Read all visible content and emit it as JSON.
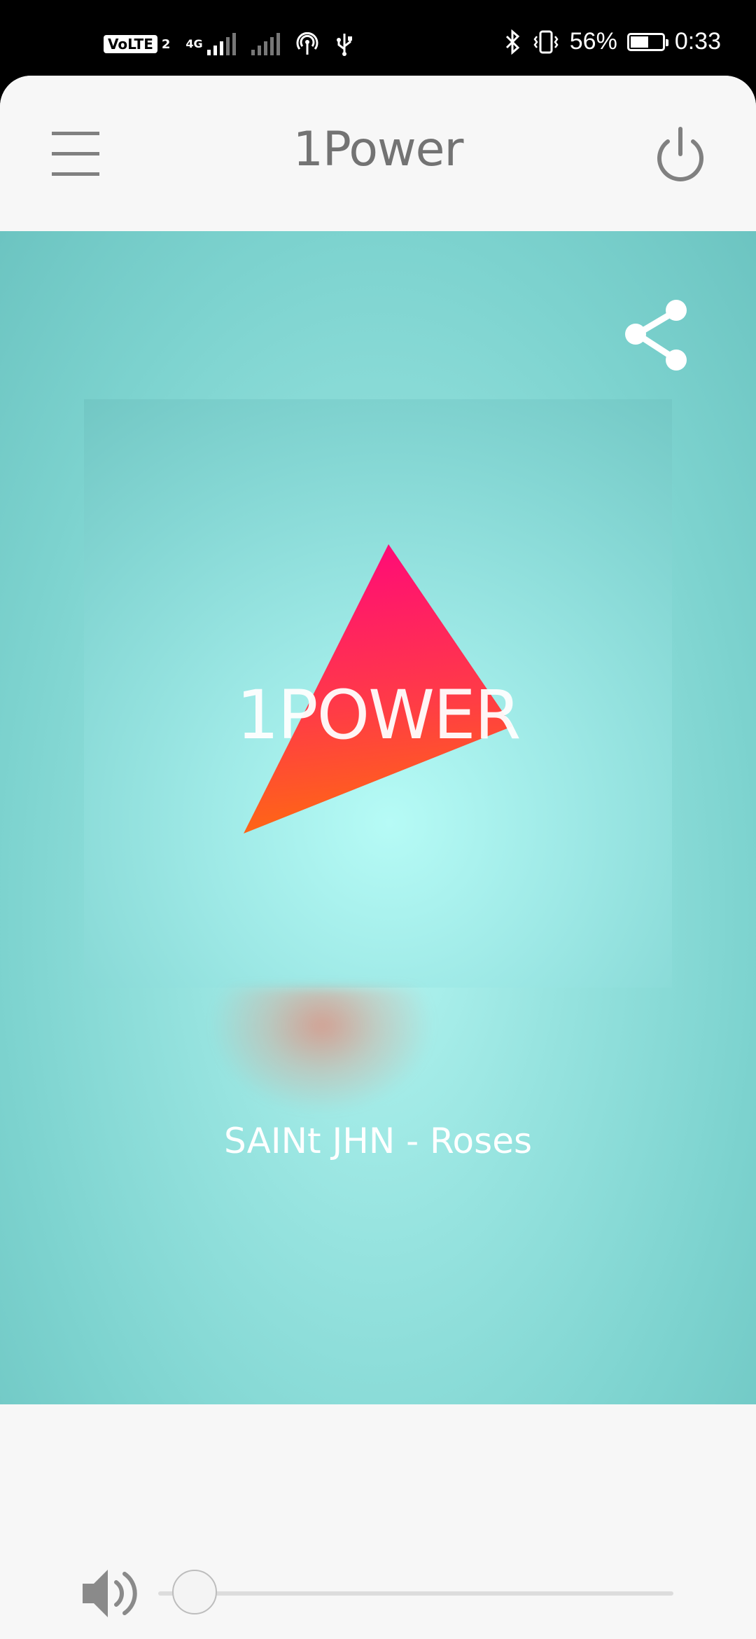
{
  "status_bar": {
    "volte_label": "VoLTE",
    "sim_label": "2",
    "network_type": "4G",
    "battery_percent": "56%",
    "battery_level": 0.56,
    "time": "0:33"
  },
  "header": {
    "title": "1Power",
    "menu_icon": "hamburger-menu-icon",
    "power_icon": "power-icon"
  },
  "player": {
    "share_icon": "share-icon",
    "cover_text": "1POWER",
    "now_playing": "SAINt JHN - Roses",
    "colors": {
      "background_light": "#b3f5f1",
      "background_dark": "#6cc4c1",
      "triangle_top": "#ff0a78",
      "triangle_bottom": "#ff6a10"
    }
  },
  "controls": {
    "volume_icon": "volume-icon",
    "volume_level": 0.07
  }
}
